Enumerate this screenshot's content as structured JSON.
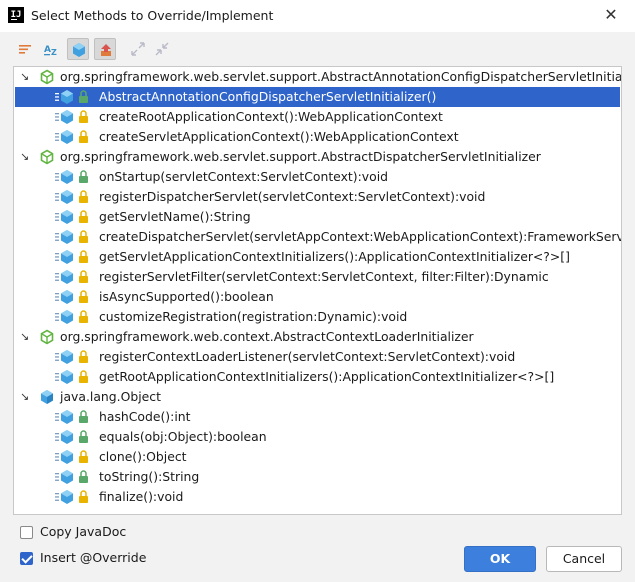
{
  "window": {
    "title": "Select Methods to Override/Implement",
    "app_icon_text": "IJ"
  },
  "toolbar": {
    "items": [
      "sort-icon",
      "sort-alpha-icon",
      "show-classes-icon",
      "show-supers-icon",
      "expand-all-icon",
      "collapse-all-icon"
    ]
  },
  "tree": {
    "rows": [
      {
        "kind": "class",
        "icon": "class-icon",
        "label": "org.springframework.web.servlet.support.AbstractAnnotationConfigDispatcherServletInitializer"
      },
      {
        "kind": "method",
        "access": "public",
        "label": "AbstractAnnotationConfigDispatcherServletInitializer()",
        "selected": true
      },
      {
        "kind": "method",
        "access": "protected",
        "label": "createRootApplicationContext():WebApplicationContext"
      },
      {
        "kind": "method",
        "access": "protected",
        "label": "createServletApplicationContext():WebApplicationContext"
      },
      {
        "kind": "class",
        "icon": "class-icon",
        "label": "org.springframework.web.servlet.support.AbstractDispatcherServletInitializer"
      },
      {
        "kind": "method",
        "access": "public",
        "label": "onStartup(servletContext:ServletContext):void"
      },
      {
        "kind": "method",
        "access": "protected",
        "label": "registerDispatcherServlet(servletContext:ServletContext):void"
      },
      {
        "kind": "method",
        "access": "protected",
        "label": "getServletName():String"
      },
      {
        "kind": "method",
        "access": "protected",
        "label": "createDispatcherServlet(servletAppContext:WebApplicationContext):FrameworkServlet"
      },
      {
        "kind": "method",
        "access": "protected",
        "label": "getServletApplicationContextInitializers():ApplicationContextInitializer<?>[]"
      },
      {
        "kind": "method",
        "access": "protected",
        "label": "registerServletFilter(servletContext:ServletContext, filter:Filter):Dynamic"
      },
      {
        "kind": "method",
        "access": "protected",
        "label": "isAsyncSupported():boolean"
      },
      {
        "kind": "method",
        "access": "protected",
        "label": "customizeRegistration(registration:Dynamic):void"
      },
      {
        "kind": "class",
        "icon": "class-icon",
        "label": "org.springframework.web.context.AbstractContextLoaderInitializer"
      },
      {
        "kind": "method",
        "access": "protected",
        "label": "registerContextLoaderListener(servletContext:ServletContext):void"
      },
      {
        "kind": "method",
        "access": "protected",
        "label": "getRootApplicationContextInitializers():ApplicationContextInitializer<?>[]"
      },
      {
        "kind": "class",
        "icon": "object-class-icon",
        "label": "java.lang.Object"
      },
      {
        "kind": "method",
        "access": "public",
        "label": "hashCode():int"
      },
      {
        "kind": "method",
        "access": "public",
        "label": "equals(obj:Object):boolean"
      },
      {
        "kind": "method",
        "access": "protected",
        "label": "clone():Object"
      },
      {
        "kind": "method",
        "access": "public",
        "label": "toString():String"
      },
      {
        "kind": "method",
        "access": "protected",
        "label": "finalize():void"
      }
    ]
  },
  "options": {
    "copy_javadoc": {
      "label": "Copy JavaDoc",
      "checked": false
    },
    "insert_override": {
      "label": "Insert @Override",
      "checked": true
    }
  },
  "buttons": {
    "ok": "OK",
    "cancel": "Cancel"
  },
  "colors": {
    "selection": "#2f65ca",
    "ok_button": "#3d7fdc",
    "class_icon": "#62b543",
    "method_icon": "#40a0e0",
    "lock_public": "#59a869",
    "lock_protected": "#e8b400"
  }
}
